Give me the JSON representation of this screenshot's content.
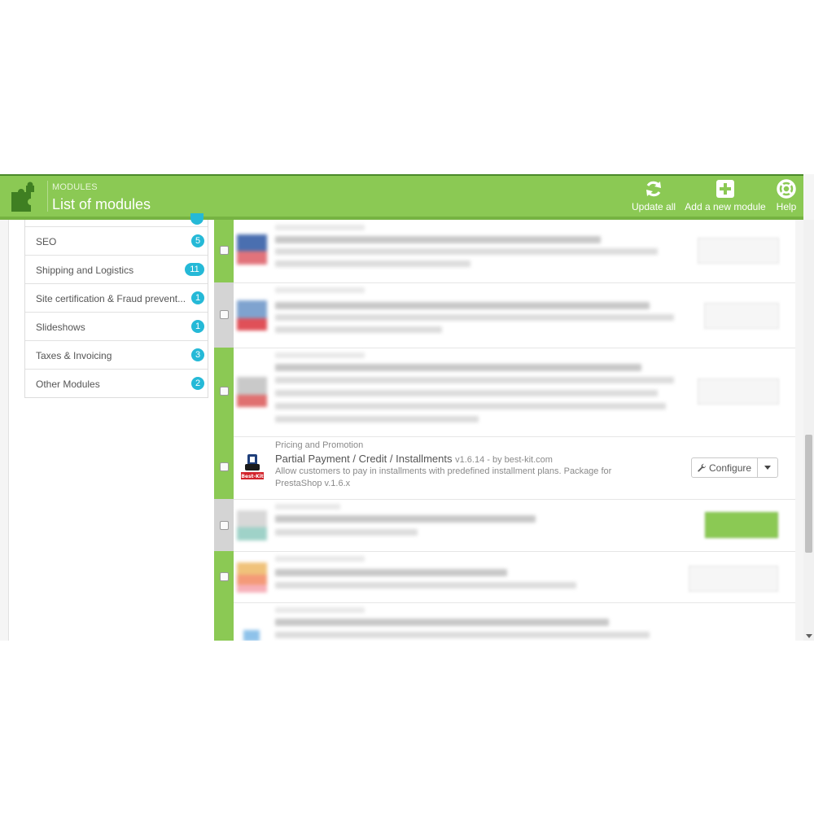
{
  "header": {
    "breadcrumb": "MODULES",
    "title": "List of modules",
    "actions": [
      {
        "label": "Update all",
        "icon": "refresh-icon"
      },
      {
        "label": "Add a new module",
        "icon": "plus-square-icon"
      },
      {
        "label": "Help",
        "icon": "lifebuoy-icon"
      }
    ]
  },
  "categories": [
    {
      "label": "SEO",
      "count": "5"
    },
    {
      "label": "Shipping and Logistics",
      "count": "11"
    },
    {
      "label": "Site certification & Fraud prevent...",
      "count": "1"
    },
    {
      "label": "Slideshows",
      "count": "1"
    },
    {
      "label": "Taxes & Invoicing",
      "count": "3"
    },
    {
      "label": "Other Modules",
      "count": "2"
    }
  ],
  "featured_module": {
    "category": "Pricing and Promotion",
    "name": "Partial Payment / Credit / Installments",
    "version": "v1.6.14 - by best-kit.com",
    "description": "Allow customers to pay in installments with predefined installment plans. Package for PrestaShop v.1.6.x",
    "configure_label": "Configure",
    "icon": "best-kit-logo"
  },
  "colors": {
    "header_green": "#8bc954",
    "badge_blue": "#25b9d7",
    "enabled_stripe": "#8bc954",
    "disabled_stripe": "#d4d4d4"
  }
}
